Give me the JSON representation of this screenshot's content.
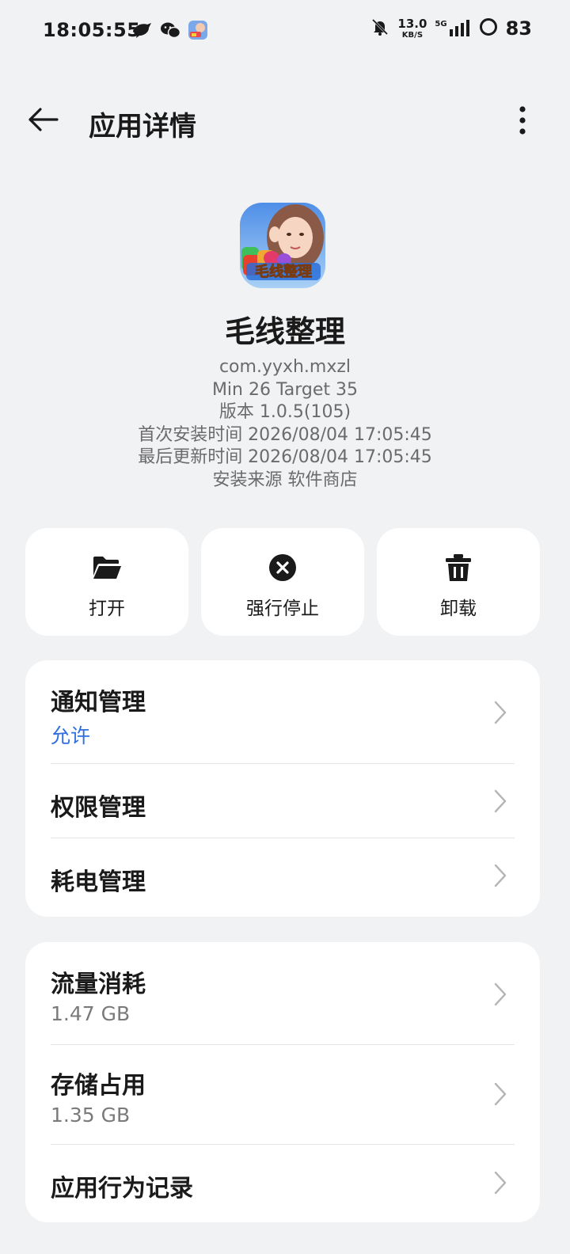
{
  "status_bar": {
    "time": "18:05:55",
    "left_icons": [
      "bird-icon",
      "wechat-icon",
      "game-app-icon"
    ],
    "net_speed_value": "13.0",
    "net_speed_unit": "KB/S",
    "network_type": "5G",
    "battery_level": "83"
  },
  "header": {
    "title": "应用详情",
    "back_icon": "arrow-left-icon",
    "more_icon": "more-vertical-icon"
  },
  "app": {
    "name": "毛线整理",
    "package": "com.yyxh.mxzl",
    "sdk": "Min 26 Target 35",
    "version": "版本 1.0.5(105)",
    "first_install": "首次安装时间 2026/08/04 17:05:45",
    "last_update": "最后更新时间 2026/08/04 17:05:45",
    "install_source": "安装来源 软件商店"
  },
  "actions": [
    {
      "label": "打开",
      "icon": "folder-open-icon"
    },
    {
      "label": "强行停止",
      "icon": "close-circle-icon"
    },
    {
      "label": "卸载",
      "icon": "trash-icon"
    }
  ],
  "settings_card": {
    "items": [
      {
        "title": "通知管理",
        "subtitle": "允许"
      },
      {
        "title": "权限管理"
      },
      {
        "title": "耗电管理"
      }
    ]
  },
  "usage_card": {
    "items": [
      {
        "title": "流量消耗",
        "subtitle": "1.47 GB"
      },
      {
        "title": "存储占用",
        "subtitle": "1.35 GB"
      },
      {
        "title": "应用行为记录"
      }
    ]
  },
  "colors": {
    "background": "#f1f2f4",
    "card": "#ffffff",
    "accent_blue": "#2f6fe0",
    "secondary_text": "#6b6b6b"
  }
}
